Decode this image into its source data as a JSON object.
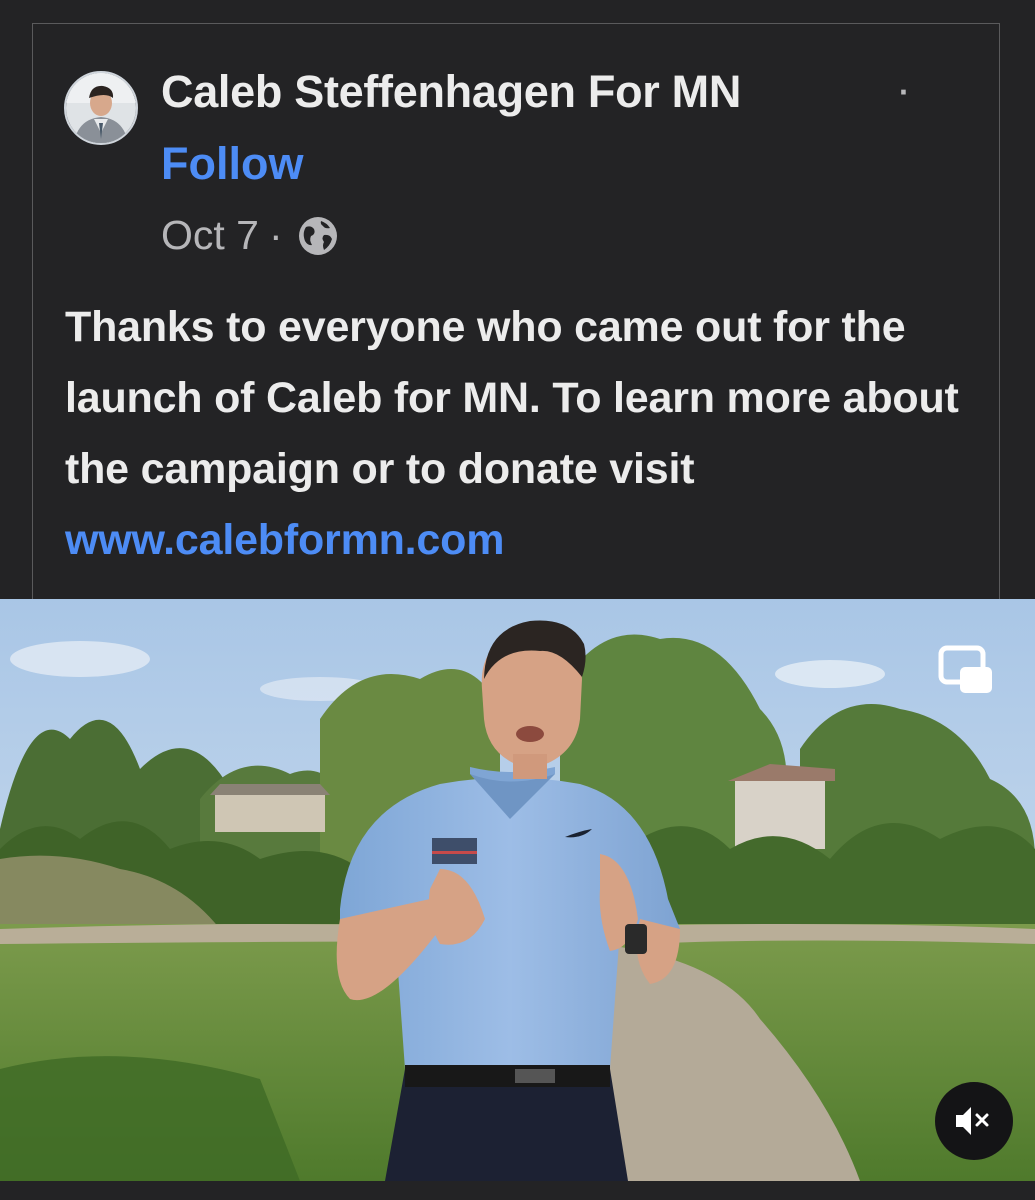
{
  "post": {
    "page_name": "Caleb Steffenhagen For MN",
    "separator": "·",
    "follow_label": "Follow",
    "date": "Oct 7",
    "date_separator": "·",
    "privacy_icon": "globe-icon",
    "text": "Thanks to everyone who came out for the launch of Caleb for MN. To learn more about the campaign or to donate visit ",
    "link_text": "www.calebformn.com"
  },
  "video": {
    "pip_icon": "picture-in-picture-icon",
    "mute_icon": "speaker-muted-icon"
  },
  "colors": {
    "background": "#232325",
    "text": "#ececec",
    "link": "#4d8cf5",
    "muted_text": "#b6b6b9"
  }
}
